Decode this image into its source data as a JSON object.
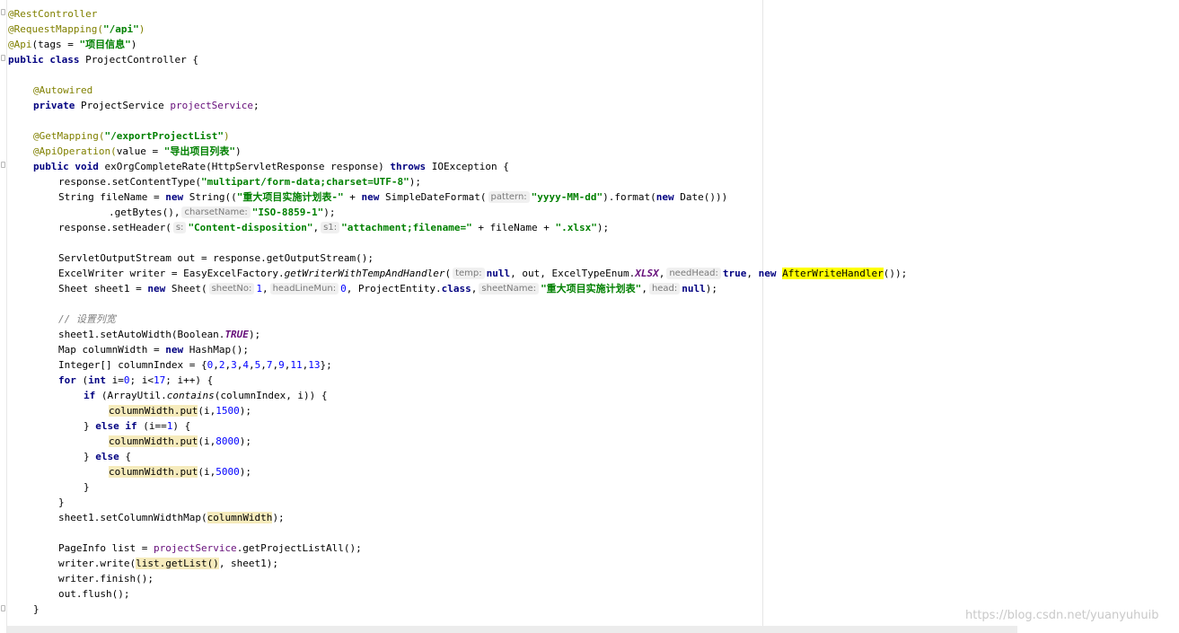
{
  "code": {
    "l1": "@RestController",
    "l2a": "@RequestMapping(",
    "l2b": "\"/api\"",
    "l2c": ")",
    "l3a": "@Api",
    "l3b": "(tags = ",
    "l3c": "\"项目信息\"",
    "l3d": ")",
    "l4a": "public class",
    "l4b": " ProjectController {",
    "l6": "@Autowired",
    "l7a": "private",
    "l7b": " ProjectService ",
    "l7c": "projectService",
    "l7d": ";",
    "l9a": "@GetMapping(",
    "l9b": "\"/exportProjectList\"",
    "l9c": ")",
    "l10a": "@ApiOperation(",
    "l10b": "value = ",
    "l10c": "\"导出项目列表\"",
    "l10d": ")",
    "l11a": "public void",
    "l11b": " exOrgCompleteRate(HttpServletResponse response) ",
    "l11c": "throws",
    "l11d": " IOException {",
    "l12a": "response.setContentType(",
    "l12b": "\"multipart/form-data;charset=UTF-8\"",
    "l12c": ");",
    "l13a": "String fileName = ",
    "l13b": "new",
    "l13c": " String((",
    "l13d": "\"重大项目实施计划表-\"",
    "l13e": " + ",
    "l13f": "new",
    "l13g": " SimpleDateFormat(",
    "l13h": "pattern:",
    "l13i": "\"yyyy-MM-dd\"",
    "l13j": ").format(",
    "l13k": "new",
    "l13l": " Date()))",
    "l14a": ".getBytes(),",
    "l14b": "charsetName:",
    "l14c": "\"ISO-8859-1\"",
    "l14d": ");",
    "l15a": "response.setHeader(",
    "l15b": "s:",
    "l15c": "\"Content-disposition\"",
    "l15d": ",",
    "l15e": "s1:",
    "l15f": "\"attachment;filename=\"",
    "l15g": " + fileName + ",
    "l15h": "\".xlsx\"",
    "l15i": ");",
    "l17": "ServletOutputStream out = response.getOutputStream();",
    "l18a": "ExcelWriter writer = EasyExcelFactory.",
    "l18b": "getWriterWithTempAndHandler",
    "l18c": "(",
    "l18d": "temp:",
    "l18e": "null",
    "l18f": ", out, ExcelTypeEnum.",
    "l18g": "XLSX",
    "l18h": ",",
    "l18i": "needHead:",
    "l18j": "true",
    "l18k": ", ",
    "l18l": "new",
    "l18m": " ",
    "l18n": "AfterWriteHandler",
    "l18o": "());",
    "l19a": "Sheet sheet1 = ",
    "l19b": "new",
    "l19c": " Sheet(",
    "l19d": "sheetNo:",
    "l19e": "1",
    "l19f": ",",
    "l19g": "headLineMun:",
    "l19h": "0",
    "l19i": ", ProjectEntity.",
    "l19j": "class",
    "l19k": ",",
    "l19l": "sheetName:",
    "l19m": "\"重大项目实施计划表\"",
    "l19n": ",",
    "l19o": "head:",
    "l19p": "null",
    "l19q": ");",
    "l21": "// 设置列宽",
    "l22a": "sheet1.setAutoWidth(Boolean.",
    "l22b": "TRUE",
    "l22c": ");",
    "l23a": "Map columnWidth = ",
    "l23b": "new",
    "l23c": " HashMap();",
    "l24a": "Integer[] columnIndex = {",
    "l24b": "0",
    "l24c": ",",
    "l24d": "2",
    "l24e": ",",
    "l24f": "3",
    "l24g": ",",
    "l24h": "4",
    "l24i": ",",
    "l24j": "5",
    "l24k": ",",
    "l24l": "7",
    "l24m": ",",
    "l24n": "9",
    "l24o": ",",
    "l24p": "11",
    "l24q": ",",
    "l24r": "13",
    "l24s": "};",
    "l25a": "for",
    "l25b": " (",
    "l25c": "int",
    "l25d": " i=",
    "l25e": "0",
    "l25f": "; i<",
    "l25g": "17",
    "l25h": "; i++) {",
    "l26a": "if",
    "l26b": " (ArrayUtil.",
    "l26c": "contains",
    "l26d": "(columnIndex, i)) {",
    "l27a": "columnWidth.put",
    "l27b": "(i,",
    "l27c": "1500",
    "l27d": ");",
    "l28a": "} ",
    "l28b": "else if",
    "l28c": " (i==",
    "l28d": "1",
    "l28e": ") {",
    "l29a": "columnWidth.put",
    "l29b": "(i,",
    "l29c": "8000",
    "l29d": ");",
    "l30a": "} ",
    "l30b": "else",
    "l30c": " {",
    "l31a": "columnWidth.put",
    "l31b": "(i,",
    "l31c": "5000",
    "l31d": ");",
    "l32": "}",
    "l33": "}",
    "l34a": "sheet1.setColumnWidthMap(",
    "l34b": "columnWidth",
    "l34c": ");",
    "l36a": "PageInfo list = ",
    "l36b": "projectService",
    "l36c": ".getProjectListAll();",
    "l37a": "writer.write(",
    "l37b": "list.getList()",
    "l37c": ", sheet1);",
    "l38": "writer.finish();",
    "l39": "out.flush();",
    "l40": "}"
  },
  "watermark": "https://blog.csdn.net/yuanyuhuib"
}
